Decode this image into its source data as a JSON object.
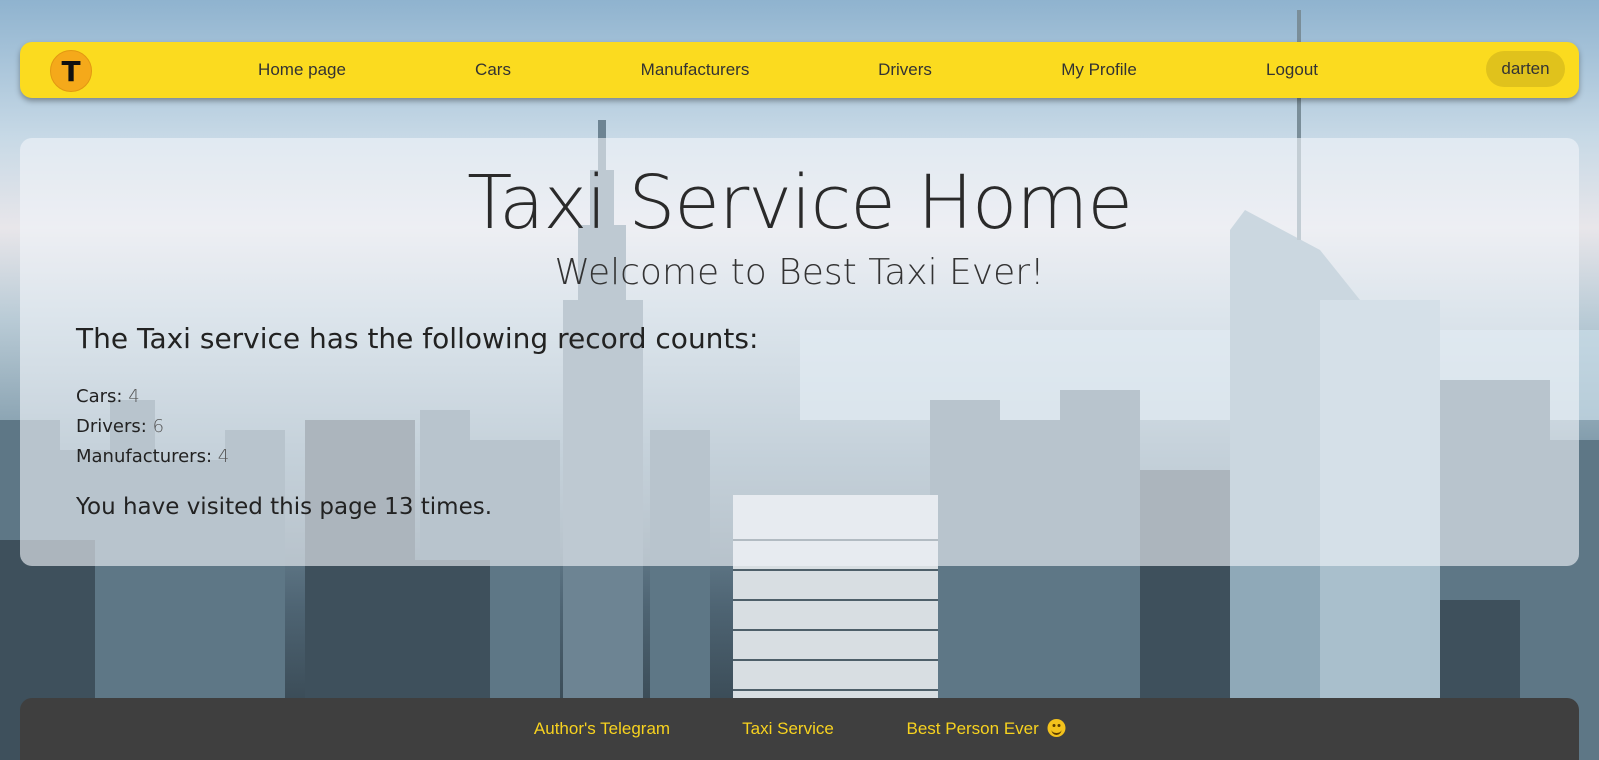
{
  "nav": {
    "logo_letter": "T",
    "links": [
      {
        "label": "Home page"
      },
      {
        "label": "Cars"
      },
      {
        "label": "Manufacturers"
      },
      {
        "label": "Drivers"
      },
      {
        "label": "My Profile"
      },
      {
        "label": "Logout"
      }
    ],
    "user": "darten"
  },
  "main": {
    "title": "Taxi Service Home",
    "subtitle": "Welcome to Best Taxi Ever!",
    "counts_heading": "The Taxi service has the following record counts:",
    "counts": [
      {
        "label": "Cars:",
        "value": "4"
      },
      {
        "label": "Drivers:",
        "value": "6"
      },
      {
        "label": "Manufacturers:",
        "value": "4"
      }
    ],
    "visits": "You have visited this page 13 times."
  },
  "footer": {
    "links": [
      {
        "label": "Author's Telegram"
      },
      {
        "label": "Taxi Service"
      },
      {
        "label": "Best Person Ever"
      }
    ],
    "emoji_icon": "smiley-face-icon"
  },
  "colors": {
    "nav_bg": "#fbdb1f",
    "logo_bg": "#f5a91a",
    "footer_bg": "#3f3f3f",
    "footer_link": "#f7d21f"
  }
}
